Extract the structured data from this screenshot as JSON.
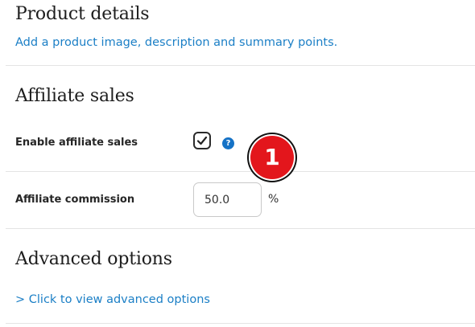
{
  "product_details": {
    "title": "Product details",
    "link": "Add a product image, description and summary points."
  },
  "affiliate_sales": {
    "title": "Affiliate sales",
    "enable_label": "Enable affiliate sales",
    "enable_checked": true,
    "help_glyph": "?",
    "commission_label": "Affiliate commission",
    "commission_value": "50.0",
    "commission_unit": "%"
  },
  "annotation": {
    "marker": "1",
    "color": "#e3161c"
  },
  "advanced_options": {
    "title": "Advanced options",
    "link": "> Click to view advanced options"
  },
  "colors": {
    "link": "#1b7fc6",
    "help": "#1572c6"
  }
}
